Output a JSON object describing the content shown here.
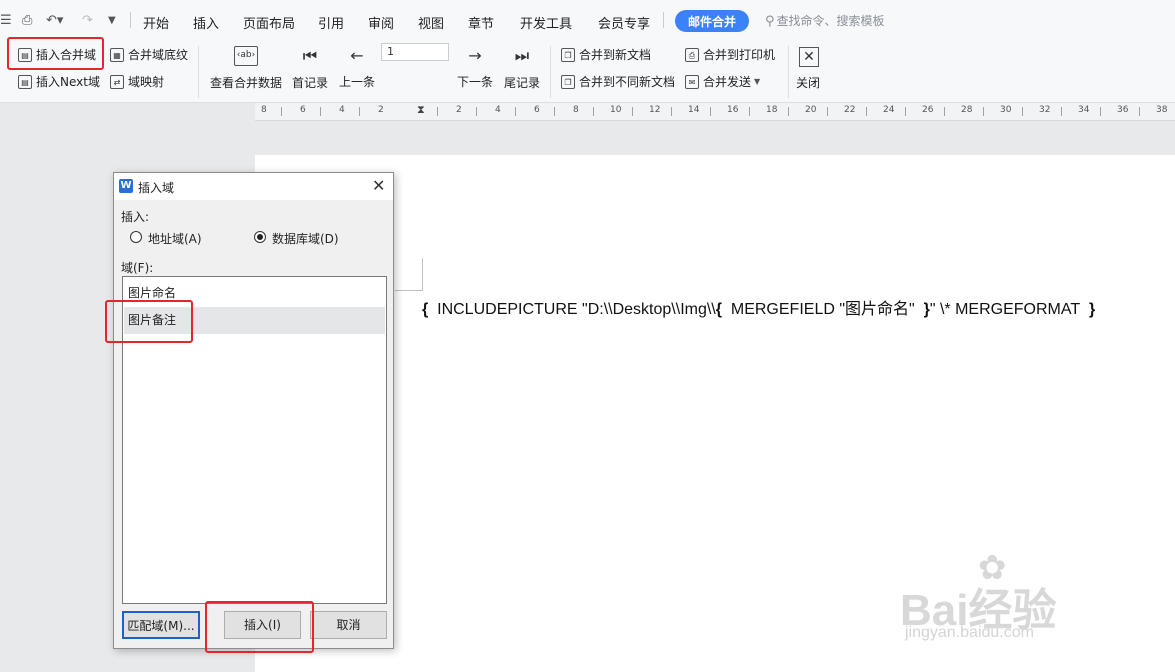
{
  "menubar": {
    "tabs": [
      "开始",
      "插入",
      "页面布局",
      "引用",
      "审阅",
      "视图",
      "章节",
      "开发工具",
      "会员专享"
    ],
    "active_tab": "邮件合并",
    "search_placeholder": "查找命令、搜索模板"
  },
  "ribbon": {
    "insert_merge_field": "插入合并域",
    "merge_field_shading": "合并域底纹",
    "insert_next_field": "插入Next域",
    "field_mapping": "域映射",
    "view_merged_data": "查看合并数据",
    "first_record": "首记录",
    "prev_record": "上一条",
    "record_number": "1",
    "next_record": "下一条",
    "last_record": "尾记录",
    "merge_to_new_doc": "合并到新文档",
    "merge_to_different_docs": "合并到不同新文档",
    "merge_to_printer": "合并到打印机",
    "merge_send": "合并发送",
    "close": "关闭"
  },
  "ruler": {
    "numbers": [
      "8",
      "6",
      "4",
      "2",
      "2",
      "4",
      "6",
      "8",
      "10",
      "12",
      "14",
      "16",
      "18",
      "20",
      "22",
      "24",
      "26",
      "28",
      "30",
      "32",
      "34",
      "36",
      "38"
    ]
  },
  "document": {
    "open_brace": "{",
    "field_prefix": "INCLUDEPICTURE \"D:\\\\Desktop\\\\Img\\\\",
    "inner_open": "{",
    "inner_field": "MERGEFIELD \"图片命名\"",
    "inner_close": "}",
    "field_suffix": "\" \\* MERGEFORMAT",
    "close_brace": "}"
  },
  "dialog": {
    "title": "插入域",
    "insert_label": "插入:",
    "radio_address": "地址域(A)",
    "radio_database": "数据库域(D)",
    "field_label": "域(F):",
    "fields": [
      "图片命名",
      "图片备注"
    ],
    "selected_field": "图片备注",
    "match_button": "匹配域(M)...",
    "insert_button": "插入(I)",
    "cancel_button": "取消"
  },
  "watermark": {
    "brand": "Bai经验",
    "url": "jingyan.baidu.com"
  },
  "colors": {
    "accent": "#3b82f6",
    "highlight_box": "#e8242c"
  }
}
